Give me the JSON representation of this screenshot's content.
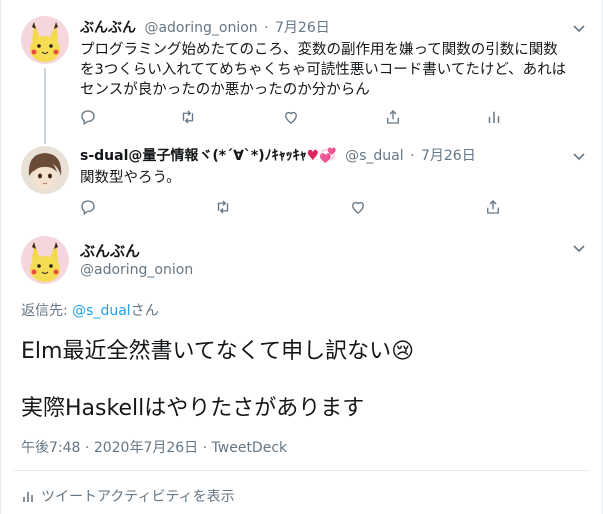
{
  "colors": {
    "accent": "#1da1f2",
    "secondary_text": "#657786",
    "heart": "#e0245e",
    "divider": "#e6ecf0"
  },
  "tweets": [
    {
      "name": "ぶんぶん",
      "handle": "@adoring_onion",
      "separator": "·",
      "date": "7月26日",
      "lines": [
        "プログラミング始めたてのころ、変数の副作用を嫌って関数の引数に関数",
        "を3つくらい入れててめちゃくちゃ可読性悪いコード書いてたけど、あれは",
        "センスが良かったのか悪かったのか分からん"
      ],
      "actions": [
        "reply-icon",
        "retweet-icon",
        "like-icon",
        "share-icon",
        "analytics-icon"
      ]
    },
    {
      "name_prefix": "s-dual@量子情報ヾ(*ˊ∀ˋ*)ﾉｷｬｯｷｬ",
      "name_hearts": "♥💞",
      "handle": "@s_dual",
      "separator": "·",
      "date": "7月26日",
      "lines": [
        "関数型やろう。"
      ],
      "actions": [
        "reply-icon",
        "retweet-icon",
        "like-icon",
        "share-icon"
      ]
    }
  ],
  "focus": {
    "name": "ぶんぶん",
    "handle": "@adoring_onion",
    "reply_prefix": "返信先: ",
    "reply_link": "@s_dual",
    "reply_suffix": "さん",
    "line1": "Elm最近全然書いてなくて申し訳ない",
    "emoji": "😢",
    "line2": "実際Haskellはやりたさがあります",
    "time": "午後7:48",
    "separator": " · ",
    "date": "2020年7月26日",
    "source": "TweetDeck",
    "activity": "ツイートアクティビティを表示"
  }
}
